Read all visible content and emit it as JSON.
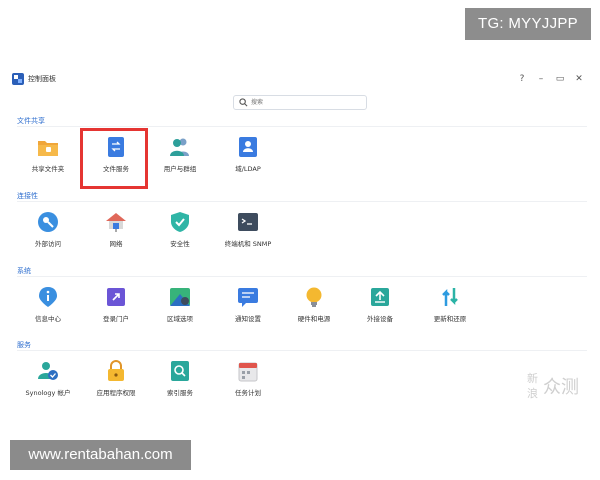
{
  "watermarks": {
    "top_tag": "TG: MYYJJPP",
    "bottom_tag": "www.rentabahan.com",
    "corner_a": "新",
    "corner_b": "浪",
    "corner_c": "众测"
  },
  "window": {
    "title": "控制面板",
    "controls": {
      "help": "?",
      "minimize": "–",
      "maximize": "▭",
      "close": "✕"
    }
  },
  "search": {
    "placeholder": "搜索"
  },
  "sections": [
    {
      "title": "文件共享",
      "items": [
        {
          "label": "共享文件夹",
          "icon": "folder-icon"
        },
        {
          "label": "文件服务",
          "icon": "file-services-icon"
        },
        {
          "label": "用户与群组",
          "icon": "users-icon"
        },
        {
          "label": "域/LDAP",
          "icon": "domain-icon"
        }
      ]
    },
    {
      "title": "连接性",
      "items": [
        {
          "label": "外部访问",
          "icon": "external-access-icon"
        },
        {
          "label": "网络",
          "icon": "network-icon"
        },
        {
          "label": "安全性",
          "icon": "security-icon"
        },
        {
          "label": "终端机和 SNMP",
          "icon": "terminal-icon"
        }
      ]
    },
    {
      "title": "系统",
      "items": [
        {
          "label": "信息中心",
          "icon": "info-center-icon"
        },
        {
          "label": "登录门户",
          "icon": "login-portal-icon"
        },
        {
          "label": "区域选项",
          "icon": "regional-options-icon"
        },
        {
          "label": "通知设置",
          "icon": "notification-icon"
        },
        {
          "label": "硬件和电源",
          "icon": "hardware-power-icon"
        },
        {
          "label": "外接设备",
          "icon": "external-devices-icon"
        },
        {
          "label": "更新和还原",
          "icon": "update-restore-icon"
        }
      ]
    },
    {
      "title": "服务",
      "items": [
        {
          "label": "Synology 帐户",
          "icon": "synology-account-icon"
        },
        {
          "label": "应用程序权限",
          "icon": "app-privileges-icon"
        },
        {
          "label": "索引服务",
          "icon": "indexing-service-icon"
        },
        {
          "label": "任务计划",
          "icon": "task-scheduler-icon"
        }
      ]
    }
  ],
  "colors": {
    "accent": "#2f6fcf",
    "highlight_box": "#e53532"
  }
}
